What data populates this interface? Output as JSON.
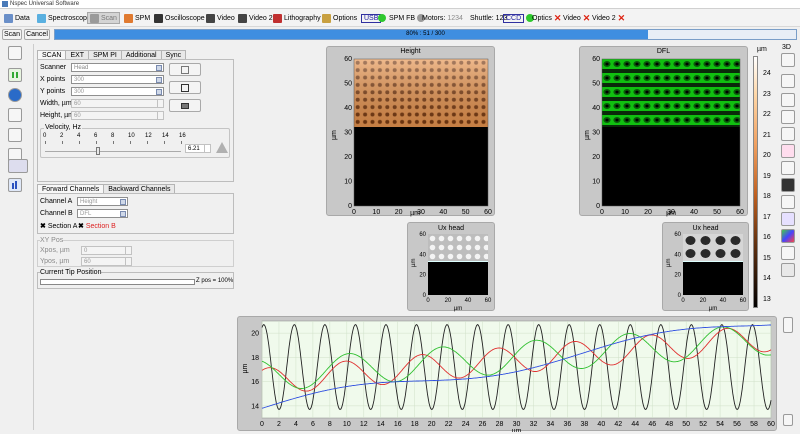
{
  "window": {
    "title": "Nspec Universal Software"
  },
  "menu": {
    "data": "Data",
    "spectroscopy": "Spectroscopy",
    "scan": "Scan",
    "spm": "SPM",
    "oscilloscope": "Oscilloscope",
    "video": "Video",
    "video2": "Video 2",
    "lithography": "Lithography",
    "options": "Options",
    "usb": "USB",
    "spmfb": "SPM FB",
    "motors": "Motors: ",
    "motors_val": "1234",
    "shuttle": "Shuttle: 123",
    "ccd": "CCD",
    "optics": "Optics",
    "video_status": "Video",
    "video2_status": "Video 2"
  },
  "progress": {
    "scan_btn": "Scan",
    "cancel_btn": "Cancel",
    "text": "80% : 51 / 300",
    "fraction": 0.8
  },
  "scan_panel": {
    "tabs": [
      "SCAN",
      "EXT",
      "SPM PI",
      "Additional",
      "Sync"
    ],
    "scanner_label": "Scanner",
    "scanner_value": "Head",
    "xpoints_label": "X points",
    "xpoints_value": "300",
    "ypoints_label": "Y points",
    "ypoints_value": "300",
    "width_label": "Width, µm",
    "width_value": "60",
    "height_label": "Height, µm",
    "height_value": "60",
    "velocity_label": "Velocity, Hz",
    "velocity_ticks": [
      "0",
      "2",
      "4",
      "6",
      "8",
      "10",
      "12",
      "14",
      "16"
    ],
    "velocity_value": "6.21",
    "velocity_fraction": 0.39
  },
  "channels_panel": {
    "tabs": [
      "Forward Channels",
      "Backward Channels"
    ],
    "chA_label": "Channel A",
    "chA_value": "Height",
    "chB_label": "Channel B",
    "chB_value": "DFL",
    "secA": "Section A",
    "secB": "Section B"
  },
  "xy_panel": {
    "title": "XY Pos",
    "xpos_label": "Xpos, µm",
    "xpos_value": "0",
    "ypos_label": "Ypos, µm",
    "ypos_value": "60"
  },
  "tip_panel": {
    "title": "Current Tip Position",
    "zpos": "Z pos = 100%"
  },
  "images": {
    "height_title": "Height",
    "dfl_title": "DFL",
    "ux1_title": "Ux head",
    "ux2_title": "Ux head",
    "unit": "µm",
    "y_ticks": [
      "0",
      "10",
      "20",
      "30",
      "40",
      "50",
      "60"
    ],
    "x_ticks": [
      "0",
      "10",
      "20",
      "30",
      "40",
      "50",
      "60"
    ],
    "small_ticks": [
      "0",
      "20",
      "40",
      "60"
    ]
  },
  "colorbar": {
    "unit": "µm",
    "ticks": [
      "24",
      "23",
      "22",
      "21",
      "20",
      "19",
      "18",
      "17",
      "16",
      "15",
      "14",
      "13"
    ]
  },
  "right_toolbar": {
    "label_3d": "3D"
  },
  "chart_data": {
    "type": "line",
    "xlabel": "µm",
    "ylabel": "µm",
    "x_ticks": [
      0,
      2,
      4,
      6,
      8,
      10,
      12,
      14,
      16,
      18,
      20,
      22,
      24,
      26,
      28,
      30,
      32,
      34,
      36,
      38,
      40,
      42,
      44,
      46,
      48,
      50,
      52,
      54,
      56,
      58,
      60
    ],
    "y_ticks": [
      14,
      16,
      18,
      20
    ],
    "xlim": [
      0,
      60
    ],
    "ylim": [
      13,
      21
    ],
    "series": [
      {
        "color": "#222222",
        "shape": "sine",
        "mid": 17.2,
        "amp": 3.5,
        "period": 3.6
      },
      {
        "color": "#e03030",
        "shape": "sine-trend",
        "mid": 16.0,
        "amp": 1.1,
        "period": 9.0,
        "trend": 0.06
      },
      {
        "color": "#30c030",
        "shape": "sine-trend",
        "mid": 16.5,
        "amp": 1.3,
        "period": 11.0,
        "trend": 0.05
      },
      {
        "color": "#3050e0",
        "shape": "trend",
        "start": 13.8,
        "end": 21.0
      }
    ]
  }
}
